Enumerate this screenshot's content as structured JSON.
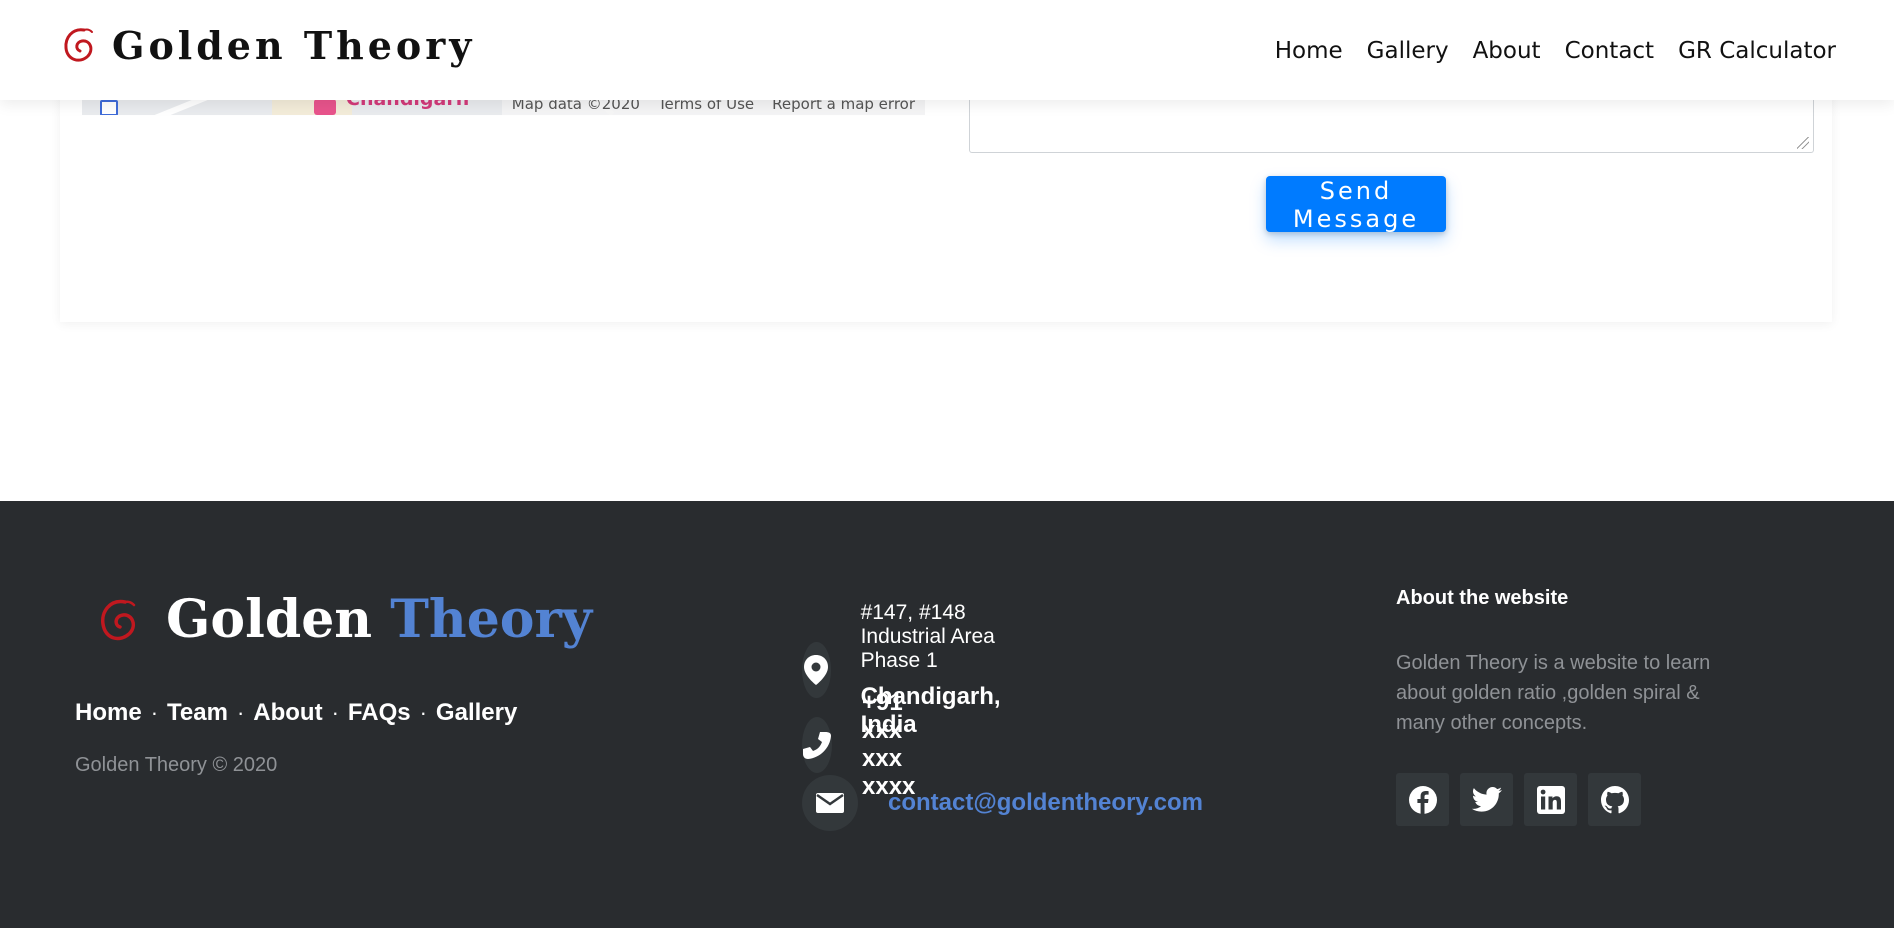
{
  "header": {
    "brand": "Golden Theory",
    "nav": [
      "Home",
      "Gallery",
      "About",
      "Contact",
      "GR Calculator"
    ]
  },
  "map": {
    "place": "Hyatt Regency\nChandigarh",
    "attribution": [
      "Map data ©2020",
      "Terms of Use",
      "Report a map error"
    ]
  },
  "form": {
    "message_value": "",
    "send_label": "Send Message"
  },
  "footer": {
    "brand_first": "Golden",
    "brand_second": "Theory",
    "links": [
      "Home",
      "Team",
      "About",
      "FAQs",
      "Gallery"
    ],
    "separator": "·",
    "copyright": "Golden Theory © 2020",
    "address_line1": "#147, #148 Industrial Area Phase 1",
    "address_line2": "Chandigarh, India",
    "phone": "+91 xxx xxx xxxx",
    "email": "contact@goldentheory.com",
    "about_heading": "About the website",
    "about_text": "Golden Theory is a website to learn about golden ratio ,golden spiral & many other concepts.",
    "social": [
      "facebook-icon",
      "twitter-icon",
      "linkedin-icon",
      "github-icon"
    ]
  },
  "colors": {
    "accent": "#5383d3",
    "button": "#007bff",
    "footer_bg": "#292c2f",
    "logo_red": "#c0181f"
  }
}
